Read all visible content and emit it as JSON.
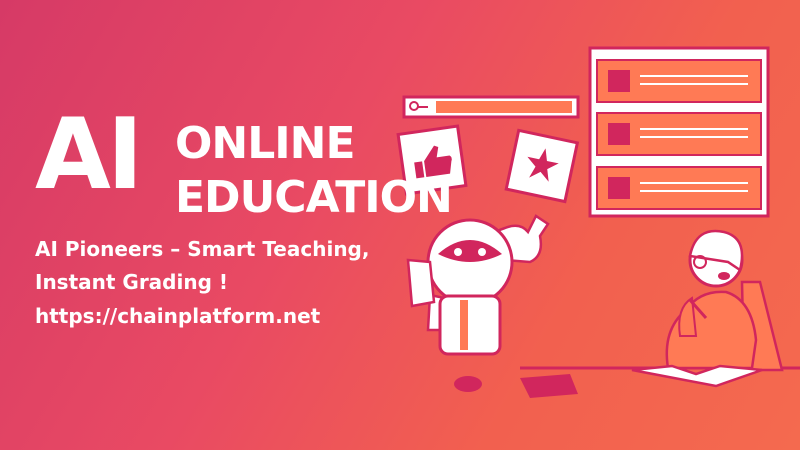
{
  "banner": {
    "ai_word": "AI",
    "headline_line1": "ONLINE",
    "headline_line2": "EDUCATION",
    "tagline_line1": "AI Pioneers – Smart Teaching,",
    "tagline_line2": "Instant Grading !",
    "url": "https://chainplatform.net"
  },
  "colors": {
    "gradient_start": "#d63a66",
    "gradient_end": "#f46a4f",
    "accent": "#d1265d",
    "accent_light": "#ff7a55",
    "white": "#ffffff"
  },
  "icons": [
    "search-icon",
    "thumbs-up-icon",
    "star-icon",
    "robot-illustration",
    "student-illustration",
    "book-icon"
  ]
}
